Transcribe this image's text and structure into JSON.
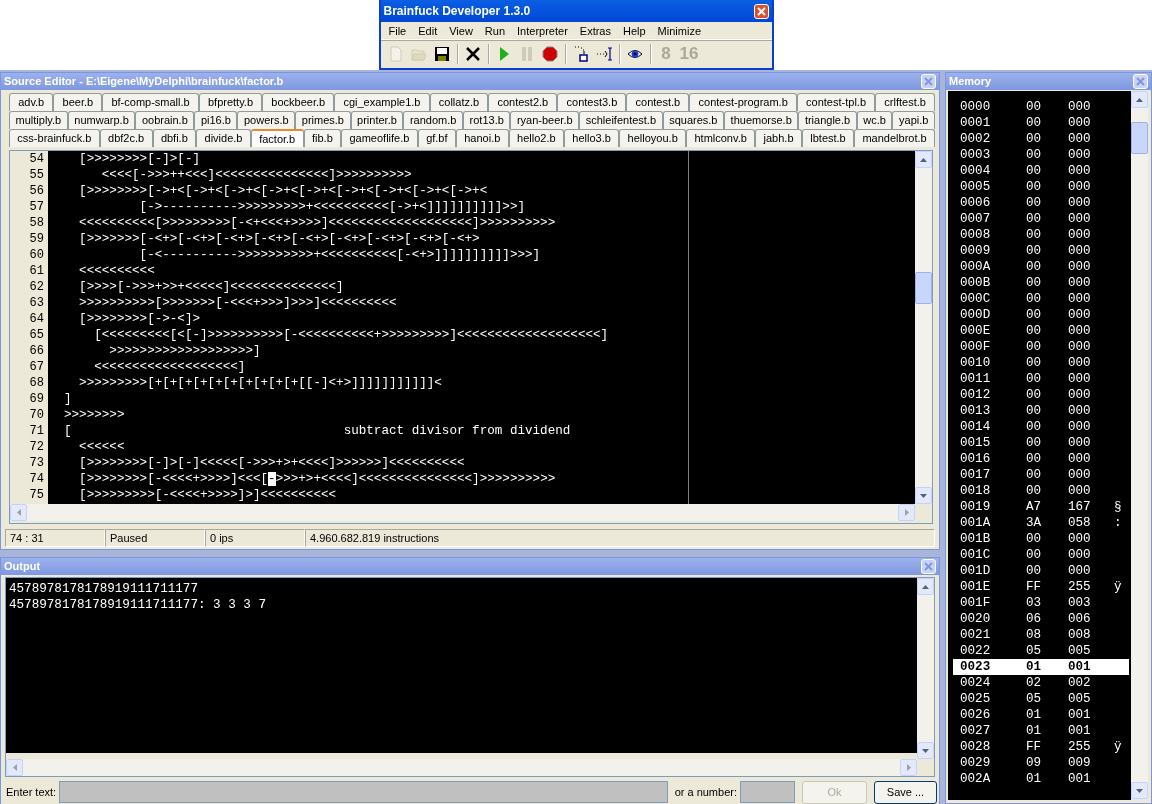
{
  "app_window": {
    "title": "Brainfuck Developer 1.3.0",
    "menu": [
      "File",
      "Edit",
      "View",
      "Run",
      "Interpreter",
      "Extras",
      "Help",
      "Minimize"
    ],
    "toolbar": [
      {
        "kind": "new",
        "disabled": true
      },
      {
        "kind": "open",
        "disabled": true
      },
      {
        "kind": "save",
        "disabled": false
      },
      {
        "kind": "sep"
      },
      {
        "kind": "delete",
        "disabled": false
      },
      {
        "kind": "sep"
      },
      {
        "kind": "run",
        "disabled": false
      },
      {
        "kind": "pause",
        "disabled": true
      },
      {
        "kind": "stop",
        "disabled": false
      },
      {
        "kind": "sep"
      },
      {
        "kind": "step",
        "disabled": false
      },
      {
        "kind": "cursor",
        "disabled": false
      },
      {
        "kind": "sep"
      },
      {
        "kind": "watch",
        "disabled": false
      },
      {
        "kind": "sep"
      },
      {
        "kind": "text",
        "label": "8",
        "disabled": true
      },
      {
        "kind": "text",
        "label": "16",
        "disabled": true
      }
    ]
  },
  "source_editor": {
    "title": "Source Editor - E:\\Eigene\\MyDelphi\\brainfuck\\factor.b",
    "tab_rows": [
      [
        {
          "label": "adv.b",
          "selected": false
        },
        {
          "label": "beer.b",
          "selected": false
        },
        {
          "label": "bf-comp-small.b",
          "selected": false
        },
        {
          "label": "bfpretty.b",
          "selected": false
        },
        {
          "label": "bockbeer.b",
          "selected": false
        },
        {
          "label": "cgi_example1.b",
          "selected": false
        },
        {
          "label": "collatz.b",
          "selected": false
        },
        {
          "label": "contest2.b",
          "selected": false
        },
        {
          "label": "contest3.b",
          "selected": false
        },
        {
          "label": "contest.b",
          "selected": false
        },
        {
          "label": "contest-program.b",
          "selected": false
        },
        {
          "label": "contest-tpl.b",
          "selected": false
        },
        {
          "label": "crlftest.b",
          "selected": false
        }
      ],
      [
        {
          "label": "multiply.b",
          "selected": false
        },
        {
          "label": "numwarp.b",
          "selected": false
        },
        {
          "label": "oobrain.b",
          "selected": false
        },
        {
          "label": "pi16.b",
          "selected": false
        },
        {
          "label": "powers.b",
          "selected": false
        },
        {
          "label": "primes.b",
          "selected": false
        },
        {
          "label": "printer.b",
          "selected": false
        },
        {
          "label": "random.b",
          "selected": false
        },
        {
          "label": "rot13.b",
          "selected": false
        },
        {
          "label": "ryan-beer.b",
          "selected": false
        },
        {
          "label": "schleifentest.b",
          "selected": false
        },
        {
          "label": "squares.b",
          "selected": false
        },
        {
          "label": "thuemorse.b",
          "selected": false
        },
        {
          "label": "triangle.b",
          "selected": false
        },
        {
          "label": "wc.b",
          "selected": false
        },
        {
          "label": "yapi.b",
          "selected": false
        }
      ],
      [
        {
          "label": "css-brainfuck.b",
          "selected": false
        },
        {
          "label": "dbf2c.b",
          "selected": false
        },
        {
          "label": "dbfi.b",
          "selected": false
        },
        {
          "label": "divide.b",
          "selected": false
        },
        {
          "label": "factor.b",
          "selected": true
        },
        {
          "label": "fib.b",
          "selected": false
        },
        {
          "label": "gameoflife.b",
          "selected": false
        },
        {
          "label": "gf.bf",
          "selected": false
        },
        {
          "label": "hanoi.b",
          "selected": false
        },
        {
          "label": "hello2.b",
          "selected": false
        },
        {
          "label": "hello3.b",
          "selected": false
        },
        {
          "label": "helloyou.b",
          "selected": false
        },
        {
          "label": "htmlconv.b",
          "selected": false
        },
        {
          "label": "jabh.b",
          "selected": false
        },
        {
          "label": "lbtest.b",
          "selected": false
        },
        {
          "label": "mandelbrot.b",
          "selected": false
        }
      ]
    ],
    "lines": [
      {
        "number": "54",
        "text": "  [>>>>>>>>[-]>[-]"
      },
      {
        "number": "55",
        "text": "     <<<<[->>>++<<<]<<<<<<<<<<<<<<<]>>>>>>>>>>"
      },
      {
        "number": "56",
        "text": "  [>>>>>>>>[->+<[->+<[->+<[->+<[->+<[->+<[->+<[->+<[->+<"
      },
      {
        "number": "57",
        "text": "          [->---------->>>>>>>>>+<<<<<<<<<<[->+<]]]]]]]]]]>>]"
      },
      {
        "number": "58",
        "text": "  <<<<<<<<<<[>>>>>>>>>[-<+<<<+>>>>]<<<<<<<<<<<<<<<<<<<]>>>>>>>>>>"
      },
      {
        "number": "59",
        "text": "  [>>>>>>>[-<+>[-<+>[-<+>[-<+>[-<+>[-<+>[-<+>[-<+>[-<+>"
      },
      {
        "number": "60",
        "text": "          [-<---------->>>>>>>>>>+<<<<<<<<<<[-<+>]]]]]]]]]]>>>]"
      },
      {
        "number": "61",
        "text": "  <<<<<<<<<<"
      },
      {
        "number": "62",
        "text": "  [>>>>[->>>+>>+<<<<<]<<<<<<<<<<<<<<]"
      },
      {
        "number": "63",
        "text": "  >>>>>>>>>>[>>>>>>>[-<<<+>>>]>>>]<<<<<<<<<<"
      },
      {
        "number": "64",
        "text": "  [>>>>>>>>[->-<]>"
      },
      {
        "number": "65",
        "text": "    [<<<<<<<<<[<[-]>>>>>>>>>>[-<<<<<<<<<<+>>>>>>>>>]<<<<<<<<<<<<<<<<<<<]"
      },
      {
        "number": "66",
        "text": "      >>>>>>>>>>>>>>>>>>>]"
      },
      {
        "number": "67",
        "text": "    <<<<<<<<<<<<<<<<<<<]"
      },
      {
        "number": "68",
        "text": "  >>>>>>>>>[+[+[+[+[+[+[+[+[+[+[[-]<+>]]]]]]]]]]]<"
      },
      {
        "number": "69",
        "text": "]"
      },
      {
        "number": "70",
        "text": ">>>>>>>>"
      },
      {
        "number": "71",
        "text": "[                                    subtract divisor from dividend"
      },
      {
        "number": "72",
        "text": "  <<<<<<"
      },
      {
        "number": "73",
        "text": "  [>>>>>>>>[-]>[-]<<<<<[->>>+>+<<<<]>>>>>>]<<<<<<<<<<"
      },
      {
        "number": "74",
        "text": "  [>>>>>>>>[-<<<<+>>>>]<<<[",
        "cursor": "-",
        "after": ">>>+>+<<<<]<<<<<<<<<<<<<<<]>>>>>>>>>>"
      },
      {
        "number": "75",
        "text": "  [>>>>>>>>>[-<<<<+>>>>]>]<<<<<<<<<<"
      }
    ],
    "status_bar": [
      "74 : 31",
      "Paused",
      "0 ips",
      "4.960.682.819 instructions"
    ]
  },
  "output": {
    "title": "Output",
    "lines": [
      "4578978178178919111711177",
      "4578978178178919111711177: 3 3 3 7"
    ],
    "enter_text_label": "Enter text:",
    "number_label": "or a number:",
    "ok_button": {
      "label": "Ok",
      "disabled": true
    },
    "save_button": {
      "label": "Save ...",
      "disabled": false
    }
  },
  "memory": {
    "title": "Memory",
    "rows": [
      {
        "address": "0000",
        "hex": "00",
        "dec": "000",
        "selected": false
      },
      {
        "address": "0001",
        "hex": "00",
        "dec": "000",
        "selected": false
      },
      {
        "address": "0002",
        "hex": "00",
        "dec": "000",
        "selected": false
      },
      {
        "address": "0003",
        "hex": "00",
        "dec": "000",
        "selected": false
      },
      {
        "address": "0004",
        "hex": "00",
        "dec": "000",
        "selected": false
      },
      {
        "address": "0005",
        "hex": "00",
        "dec": "000",
        "selected": false
      },
      {
        "address": "0006",
        "hex": "00",
        "dec": "000",
        "selected": false
      },
      {
        "address": "0007",
        "hex": "00",
        "dec": "000",
        "selected": false
      },
      {
        "address": "0008",
        "hex": "00",
        "dec": "000",
        "selected": false
      },
      {
        "address": "0009",
        "hex": "00",
        "dec": "000",
        "selected": false
      },
      {
        "address": "000A",
        "hex": "00",
        "dec": "000",
        "selected": false
      },
      {
        "address": "000B",
        "hex": "00",
        "dec": "000",
        "selected": false
      },
      {
        "address": "000C",
        "hex": "00",
        "dec": "000",
        "selected": false
      },
      {
        "address": "000D",
        "hex": "00",
        "dec": "000",
        "selected": false
      },
      {
        "address": "000E",
        "hex": "00",
        "dec": "000",
        "selected": false
      },
      {
        "address": "000F",
        "hex": "00",
        "dec": "000",
        "selected": false
      },
      {
        "address": "0010",
        "hex": "00",
        "dec": "000",
        "selected": false
      },
      {
        "address": "0011",
        "hex": "00",
        "dec": "000",
        "selected": false
      },
      {
        "address": "0012",
        "hex": "00",
        "dec": "000",
        "selected": false
      },
      {
        "address": "0013",
        "hex": "00",
        "dec": "000",
        "selected": false
      },
      {
        "address": "0014",
        "hex": "00",
        "dec": "000",
        "selected": false
      },
      {
        "address": "0015",
        "hex": "00",
        "dec": "000",
        "selected": false
      },
      {
        "address": "0016",
        "hex": "00",
        "dec": "000",
        "selected": false
      },
      {
        "address": "0017",
        "hex": "00",
        "dec": "000",
        "selected": false
      },
      {
        "address": "0018",
        "hex": "00",
        "dec": "000",
        "selected": false
      },
      {
        "address": "0019",
        "hex": "A7",
        "dec": "167",
        "char": "§",
        "selected": false
      },
      {
        "address": "001A",
        "hex": "3A",
        "dec": "058",
        "char": ":",
        "selected": false
      },
      {
        "address": "001B",
        "hex": "00",
        "dec": "000",
        "selected": false
      },
      {
        "address": "001C",
        "hex": "00",
        "dec": "000",
        "selected": false
      },
      {
        "address": "001D",
        "hex": "00",
        "dec": "000",
        "selected": false
      },
      {
        "address": "001E",
        "hex": "FF",
        "dec": "255",
        "char": "ÿ",
        "selected": false
      },
      {
        "address": "001F",
        "hex": "03",
        "dec": "003",
        "selected": false
      },
      {
        "address": "0020",
        "hex": "06",
        "dec": "006",
        "selected": false
      },
      {
        "address": "0021",
        "hex": "08",
        "dec": "008",
        "selected": false
      },
      {
        "address": "0022",
        "hex": "05",
        "dec": "005",
        "selected": false
      },
      {
        "address": "0023",
        "hex": "01",
        "dec": "001",
        "selected": true
      },
      {
        "address": "0024",
        "hex": "02",
        "dec": "002",
        "selected": false
      },
      {
        "address": "0025",
        "hex": "05",
        "dec": "005",
        "selected": false
      },
      {
        "address": "0026",
        "hex": "01",
        "dec": "001",
        "selected": false
      },
      {
        "address": "0027",
        "hex": "01",
        "dec": "001",
        "selected": false
      },
      {
        "address": "0028",
        "hex": "FF",
        "dec": "255",
        "char": "ÿ",
        "selected": false
      },
      {
        "address": "0029",
        "hex": "09",
        "dec": "009",
        "selected": false
      },
      {
        "address": "002A",
        "hex": "01",
        "dec": "001",
        "selected": false
      }
    ]
  }
}
